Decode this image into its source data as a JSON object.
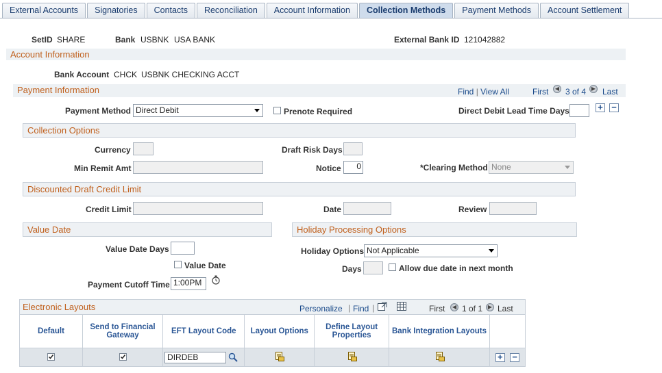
{
  "tabs": [
    {
      "label": "External Accounts",
      "active": false
    },
    {
      "label": "Signatories",
      "active": false
    },
    {
      "label": "Contacts",
      "active": false
    },
    {
      "label": "Reconciliation",
      "active": false
    },
    {
      "label": "Account Information",
      "active": false
    },
    {
      "label": "Collection Methods",
      "active": true
    },
    {
      "label": "Payment Methods",
      "active": false
    },
    {
      "label": "Account Settlement",
      "active": false
    }
  ],
  "header": {
    "setid_label": "SetID",
    "setid_value": "SHARE",
    "bank_label": "Bank",
    "bank_code": "USBNK",
    "bank_name": "USA BANK",
    "ext_bank_label": "External Bank ID",
    "ext_bank_value": "121042882"
  },
  "account_info": {
    "title": "Account Information",
    "bank_account_label": "Bank Account",
    "bank_account_code": "CHCK",
    "bank_account_desc": "USBNK CHECKING ACCT"
  },
  "payment_info": {
    "title": "Payment Information",
    "find": "Find",
    "view_all": "View All",
    "first": "First",
    "counter": "3 of 4",
    "last": "Last",
    "method_label": "Payment Method",
    "method_value": "Direct Debit",
    "prenote_label": "Prenote Required",
    "lead_time_label": "Direct Debit Lead Time Days",
    "lead_time_value": ""
  },
  "collection_options": {
    "title": "Collection Options",
    "currency_label": "Currency",
    "currency_value": "",
    "draft_risk_label": "Draft Risk Days",
    "draft_risk_value": "",
    "min_remit_label": "Min Remit Amt",
    "min_remit_value": "",
    "notice_label": "Notice",
    "notice_value": "0",
    "clearing_label": "*Clearing Method",
    "clearing_value": "None"
  },
  "discounted": {
    "title": "Discounted Draft Credit Limit",
    "credit_label": "Credit Limit",
    "date_label": "Date",
    "review_label": "Review"
  },
  "value_date": {
    "title": "Value Date",
    "days_label": "Value Date Days",
    "days_value": "",
    "checkbox_label": "Value Date",
    "cutoff_label": "Payment Cutoff Time",
    "cutoff_value": "1:00PM"
  },
  "holiday": {
    "title": "Holiday Processing Options",
    "options_label": "Holiday Options",
    "options_value": "Not Applicable",
    "days_label": "Days",
    "days_value": "",
    "allow_label": "Allow due date in next month"
  },
  "layouts": {
    "title": "Electronic Layouts",
    "personalize": "Personalize",
    "find": "Find",
    "first": "First",
    "counter": "1 of 1",
    "last": "Last",
    "columns": [
      "Default",
      "Send to Financial Gateway",
      "EFT Layout Code",
      "Layout Options",
      "Define Layout Properties",
      "Bank Integration Layouts"
    ],
    "rows": [
      {
        "default": true,
        "send_fin_gateway": true,
        "eft_code": "DIRDEB"
      }
    ]
  },
  "colors": {
    "accent": "#c0601d",
    "link": "#1a4a8a",
    "header_text": "#2a5695"
  }
}
